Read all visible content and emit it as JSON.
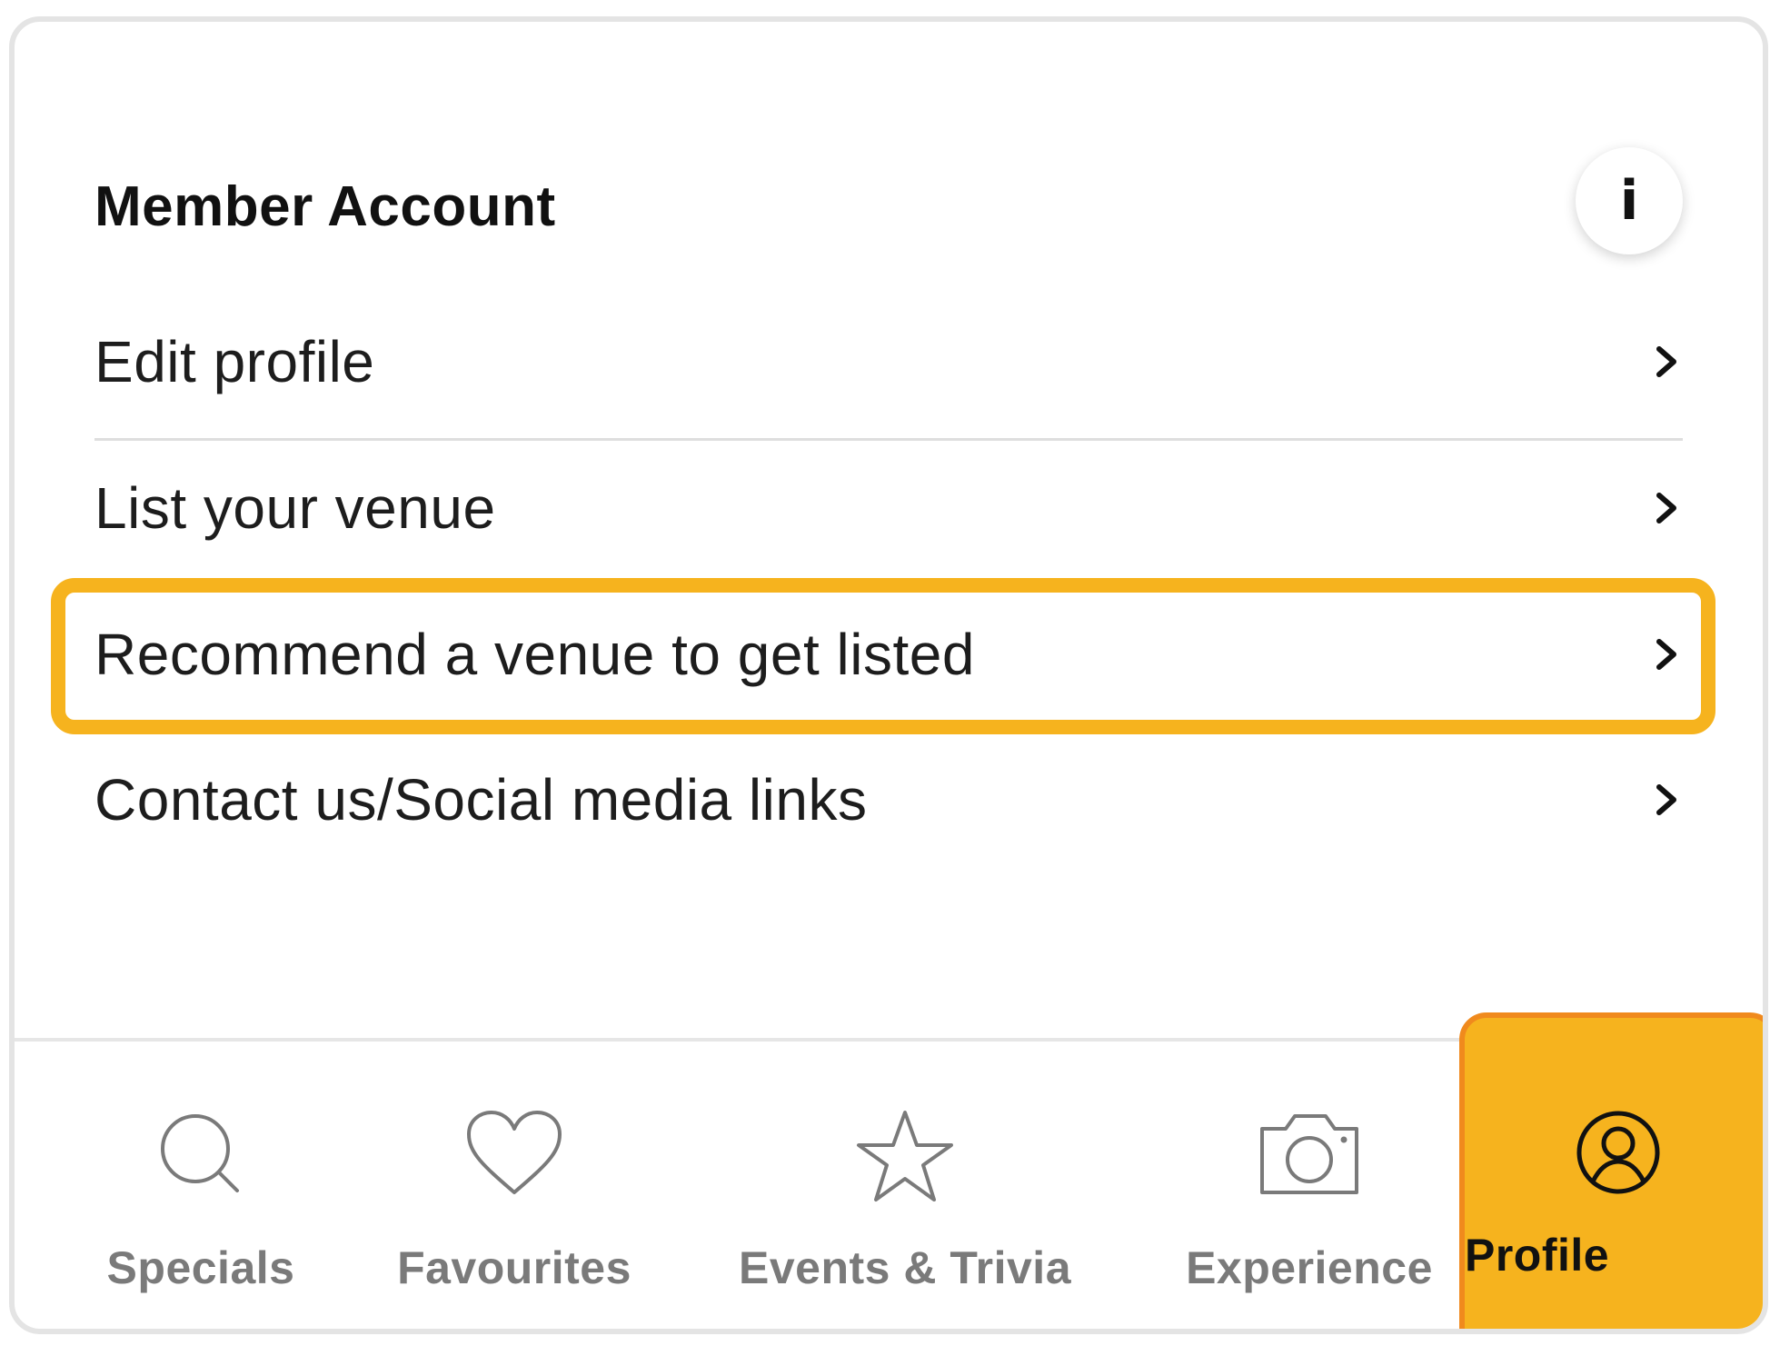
{
  "section": {
    "title": "Member Account",
    "info_label": "i"
  },
  "menu": {
    "items": [
      {
        "label": "Edit profile",
        "icon": "chevron-right-icon"
      },
      {
        "label": "List your venue",
        "icon": "chevron-right-icon"
      },
      {
        "label": "Recommend a venue to get listed",
        "icon": "chevron-right-icon",
        "highlighted": true
      },
      {
        "label": "Contact us/Social media links",
        "icon": "chevron-right-icon"
      }
    ]
  },
  "tabbar": {
    "tabs": [
      {
        "label": "Specials",
        "icon": "search-icon"
      },
      {
        "label": "Favourites",
        "icon": "heart-icon"
      },
      {
        "label": "Events & Trivia",
        "icon": "star-icon"
      },
      {
        "label": "Experience",
        "icon": "camera-icon"
      },
      {
        "label": "Profile",
        "icon": "user-circle-icon",
        "active": true
      }
    ]
  },
  "colors": {
    "accent": "#f6b31e",
    "accent_border": "#f08a1d",
    "tab_inactive": "#7a7a7a",
    "divider": "#dedede"
  }
}
